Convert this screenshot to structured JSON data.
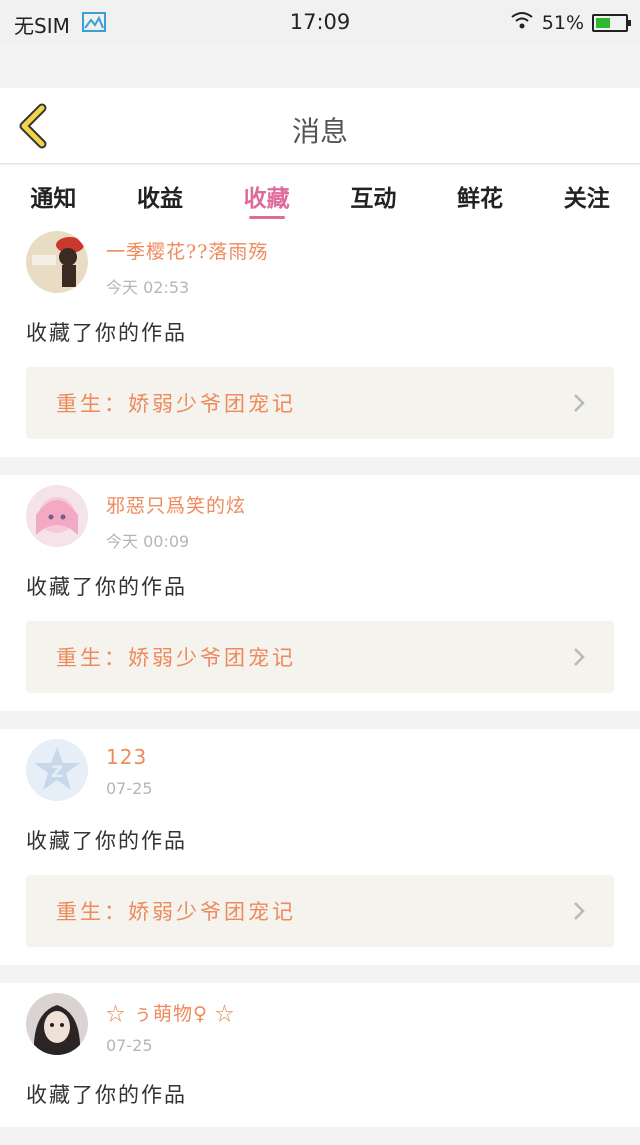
{
  "status_bar": {
    "carrier": "无SIM",
    "time": "17:09",
    "battery_percent": "51%",
    "battery_level": 0.51
  },
  "header": {
    "title": "消息"
  },
  "tabs": [
    {
      "label": "通知",
      "active": false
    },
    {
      "label": "收益",
      "active": false
    },
    {
      "label": "收藏",
      "active": true
    },
    {
      "label": "互动",
      "active": false
    },
    {
      "label": "鲜花",
      "active": false
    },
    {
      "label": "关注",
      "active": false
    }
  ],
  "messages": [
    {
      "username": "一季樱花??落雨殇",
      "time": "今天 02:53",
      "action": "收藏了你的作品",
      "work_title": "重生：娇弱少爷团宠记"
    },
    {
      "username": "邪惡只爲笑的炫",
      "time": "今天 00:09",
      "action": "收藏了你的作品",
      "work_title": "重生：娇弱少爷团宠记"
    },
    {
      "username": "123",
      "time": "07-25",
      "action": "收藏了你的作品",
      "work_title": "重生：娇弱少爷团宠记"
    },
    {
      "username": "☆ ぅ萌物♀ ☆",
      "time": "07-25",
      "action": "收藏了你的作品",
      "work_title": ""
    }
  ],
  "colors": {
    "accent_pink": "#e06b9a",
    "accent_orange": "#ee8a5c",
    "back_icon_yellow": "#f3d34a"
  }
}
